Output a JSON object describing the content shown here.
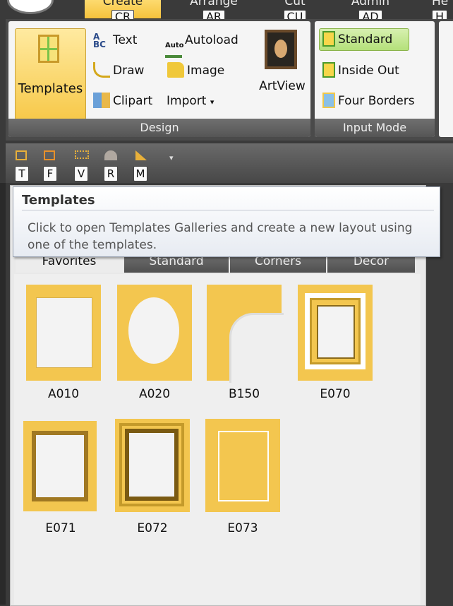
{
  "ribbon_tabs": [
    {
      "label": "Create",
      "keytip": "CR",
      "active": true
    },
    {
      "label": "Arrange",
      "keytip": "AR",
      "active": false
    },
    {
      "label": "Cut",
      "keytip": "CU",
      "active": false
    },
    {
      "label": "Admin",
      "keytip": "AD",
      "active": false
    },
    {
      "label": "He",
      "keytip": "H",
      "active": false
    }
  ],
  "design_group": {
    "title": "Design",
    "templates_label": "Templates",
    "text_label": "Text",
    "draw_label": "Draw",
    "clipart_label": "Clipart",
    "autoload_label": "Autoload",
    "autoload_icon_text": "Auto",
    "image_label": "Image",
    "import_label": "Import",
    "artview_label": "ArtView"
  },
  "input_mode_group": {
    "title": "Input Mode",
    "standard_label": "Standard",
    "inside_out_label": "Inside Out",
    "four_borders_label": "Four Borders"
  },
  "quick_access": [
    {
      "icon": "templates-qat-icon",
      "keytip": "T"
    },
    {
      "icon": "frame-qat-icon",
      "keytip": "F"
    },
    {
      "icon": "v-groove-qat-icon",
      "keytip": "V"
    },
    {
      "icon": "round-corner-qat-icon",
      "keytip": "R"
    },
    {
      "icon": "measure-qat-icon",
      "keytip": "M"
    }
  ],
  "tooltip": {
    "title": "Templates",
    "text": "Click to open Templates Galleries and create a new layout using one of the templates."
  },
  "gallery_tabs": [
    "Favorites",
    "Standard",
    "Corners",
    "Decor"
  ],
  "templates": [
    {
      "code": "A010",
      "shape": "rect-opening"
    },
    {
      "code": "A020",
      "shape": "oval-opening"
    },
    {
      "code": "B150",
      "shape": "corner-cut"
    },
    {
      "code": "E070",
      "shape": "double-frame"
    },
    {
      "code": "E071",
      "shape": "dark-border"
    },
    {
      "code": "E072",
      "shape": "thick-frame"
    },
    {
      "code": "E073",
      "shape": "thin-line"
    }
  ],
  "colors": {
    "accent_gold": "#f3c64f",
    "ribbon_dark": "#3a3a3a",
    "group_bg": "#f5f5f5"
  }
}
